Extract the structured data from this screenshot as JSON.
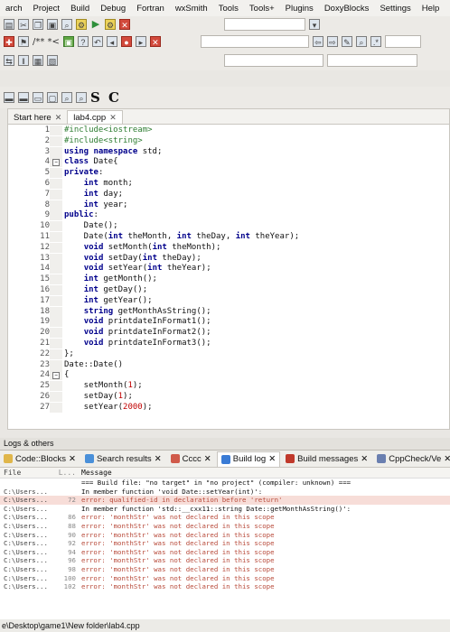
{
  "menu": [
    "arch",
    "Project",
    "Build",
    "Debug",
    "Fortran",
    "wxSmith",
    "Tools",
    "Tools+",
    "Plugins",
    "DoxyBlocks",
    "Settings",
    "Help"
  ],
  "toolbar": {
    "comment_text": "/** *<",
    "sc_label": "S C"
  },
  "editor": {
    "tabs": [
      {
        "label": "Start here",
        "active": false
      },
      {
        "label": "lab4.cpp",
        "active": true
      }
    ],
    "lines": [
      {
        "n": "1",
        "code": "#include<iostream>"
      },
      {
        "n": "2",
        "code": "#include<string>"
      },
      {
        "n": "3",
        "code": "using namespace std;"
      },
      {
        "n": "4",
        "code": "class Date{"
      },
      {
        "n": "5",
        "code": "private:"
      },
      {
        "n": "6",
        "code": "    int month;"
      },
      {
        "n": "7",
        "code": "    int day;"
      },
      {
        "n": "8",
        "code": "    int year;"
      },
      {
        "n": "9",
        "code": "public:"
      },
      {
        "n": "10",
        "code": "    Date();"
      },
      {
        "n": "11",
        "code": "    Date(int theMonth, int theDay, int theYear);"
      },
      {
        "n": "12",
        "code": "    void setMonth(int theMonth);"
      },
      {
        "n": "13",
        "code": "    void setDay(int theDay);"
      },
      {
        "n": "14",
        "code": "    void setYear(int theYear);"
      },
      {
        "n": "15",
        "code": "    int getMonth();"
      },
      {
        "n": "16",
        "code": "    int getDay();"
      },
      {
        "n": "17",
        "code": "    int getYear();"
      },
      {
        "n": "18",
        "code": "    string getMonthAsString();"
      },
      {
        "n": "19",
        "code": "    void printdateInFormat1();"
      },
      {
        "n": "20",
        "code": "    void printdateInFormat2();"
      },
      {
        "n": "21",
        "code": "    void printdateInFormat3();"
      },
      {
        "n": "22",
        "code": "};"
      },
      {
        "n": "23",
        "code": "Date::Date()"
      },
      {
        "n": "24",
        "code": "{"
      },
      {
        "n": "25",
        "code": "    setMonth(1);"
      },
      {
        "n": "26",
        "code": "    setDay(1);"
      },
      {
        "n": "27",
        "code": "    setYear(2000);"
      }
    ]
  },
  "logs": {
    "title": "Logs & others",
    "tabs": [
      {
        "label": "Code::Blocks",
        "active": false,
        "color": "#e0b64a"
      },
      {
        "label": "Search results",
        "active": false,
        "color": "#4a90d9"
      },
      {
        "label": "Cccc",
        "active": false,
        "color": "#d05a4a"
      },
      {
        "label": "Build log",
        "active": true,
        "color": "#3a7bd5"
      },
      {
        "label": "Build messages",
        "active": false,
        "color": "#c0392b"
      },
      {
        "label": "CppCheck/Ve",
        "active": false,
        "color": "#6a7fb0"
      }
    ],
    "header": {
      "file": "File",
      "line": "L...",
      "message": "Message"
    },
    "rows": [
      {
        "file": "",
        "line": "",
        "msg": "=== Build file: \"no target\" in \"no project\" (compiler: unknown) ===",
        "err": false,
        "hl": false
      },
      {
        "file": "C:\\Users...",
        "line": "",
        "msg": "In member function 'void Date::setYear(int)':",
        "err": false,
        "hl": false
      },
      {
        "file": "C:\\Users...",
        "line": "72",
        "msg": "error: qualified-id in declaration before 'return'",
        "err": true,
        "hl": true
      },
      {
        "file": "C:\\Users...",
        "line": "",
        "msg": "In member function 'std::__cxx11::string Date::getMonthAsString()':",
        "err": false,
        "hl": false
      },
      {
        "file": "C:\\Users...",
        "line": "86",
        "msg": "error: 'monthStr' was not declared in this scope",
        "err": true,
        "hl": false
      },
      {
        "file": "C:\\Users...",
        "line": "88",
        "msg": "error: 'monthStr' was not declared in this scope",
        "err": true,
        "hl": false
      },
      {
        "file": "C:\\Users...",
        "line": "90",
        "msg": "error: 'monthStr' was not declared in this scope",
        "err": true,
        "hl": false
      },
      {
        "file": "C:\\Users...",
        "line": "92",
        "msg": "error: 'monthStr' was not declared in this scope",
        "err": true,
        "hl": false
      },
      {
        "file": "C:\\Users...",
        "line": "94",
        "msg": "error: 'monthStr' was not declared in this scope",
        "err": true,
        "hl": false
      },
      {
        "file": "C:\\Users...",
        "line": "96",
        "msg": "error: 'monthStr' was not declared in this scope",
        "err": true,
        "hl": false
      },
      {
        "file": "C:\\Users...",
        "line": "98",
        "msg": "error: 'monthStr' was not declared in this scope",
        "err": true,
        "hl": false
      },
      {
        "file": "C:\\Users...",
        "line": "100",
        "msg": "error: 'monthStr' was not declared in this scope",
        "err": true,
        "hl": false
      },
      {
        "file": "C:\\Users...",
        "line": "102",
        "msg": "error: 'monthStr' was not declared in this scope",
        "err": true,
        "hl": false
      }
    ]
  },
  "status": {
    "path": "e\\Desktop\\game1\\New folder\\lab4.cpp"
  }
}
